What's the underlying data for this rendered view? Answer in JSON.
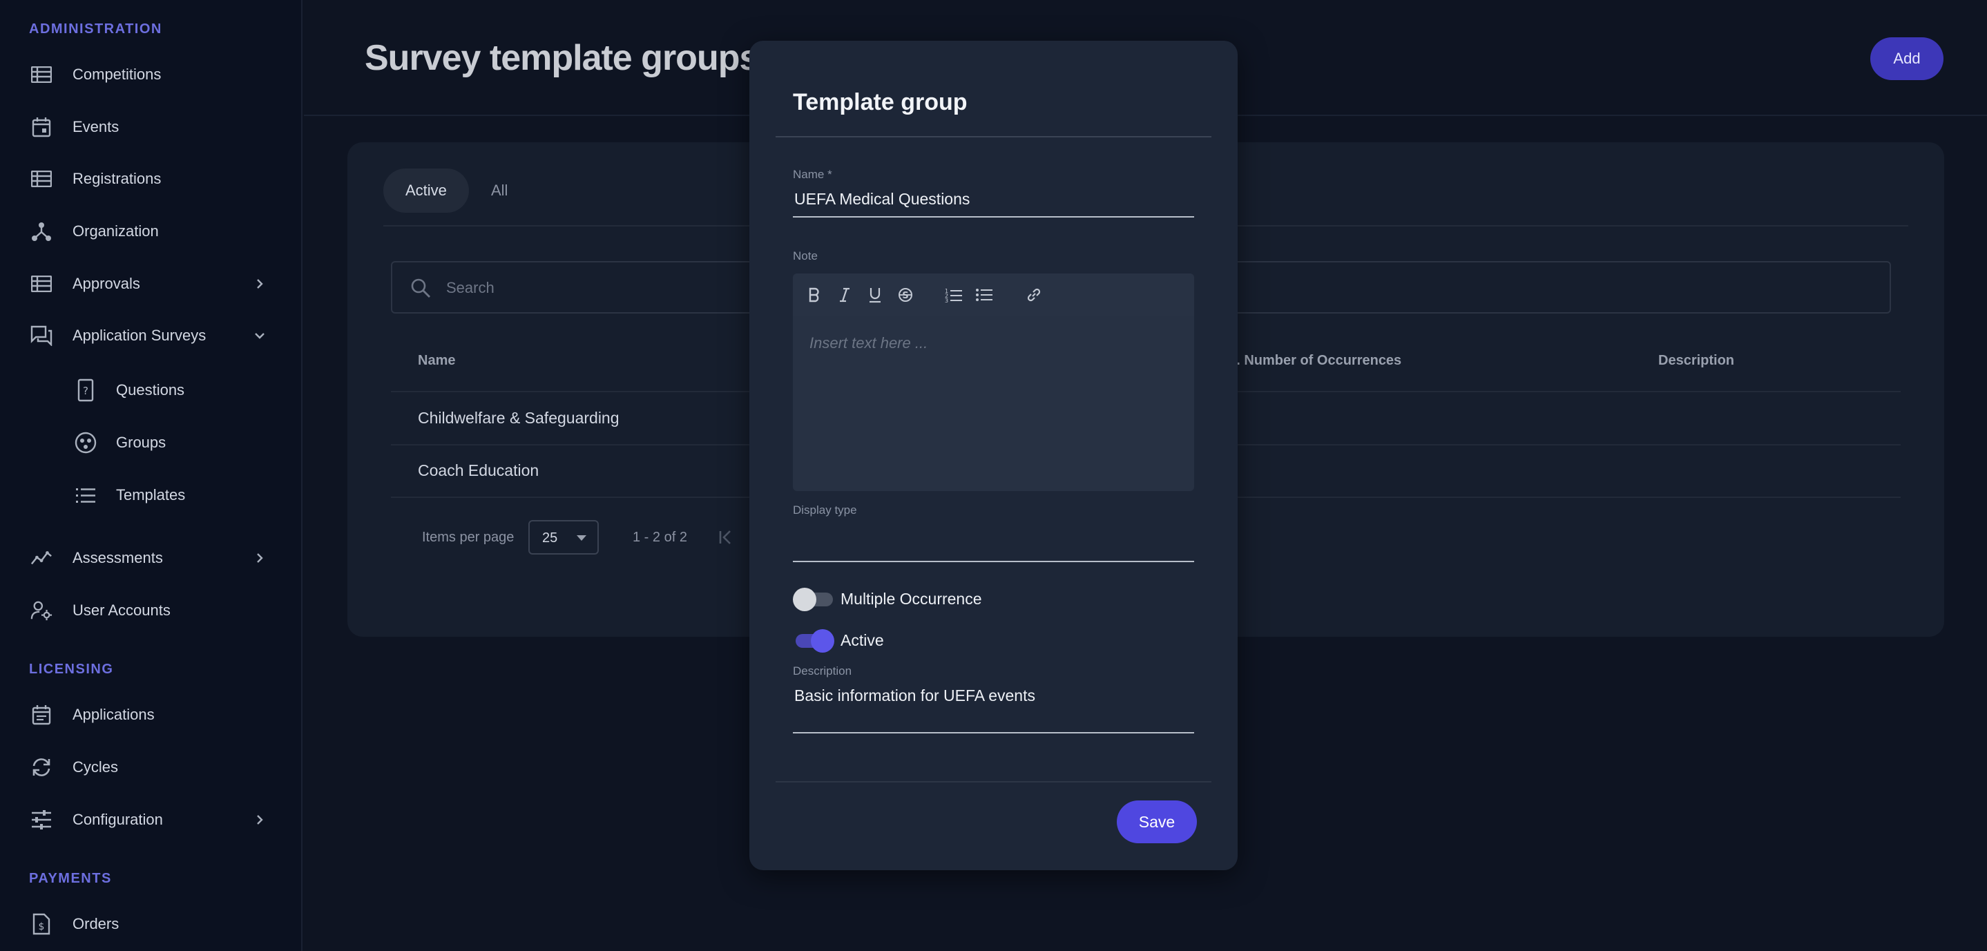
{
  "sidebar": {
    "sections": {
      "administration": "ADMINISTRATION",
      "licensing": "LICENSING",
      "payments": "PAYMENTS"
    },
    "items": {
      "competitions": {
        "label": "Competitions",
        "icon": "table-icon"
      },
      "events": {
        "label": "Events",
        "icon": "calendar-icon"
      },
      "registrations": {
        "label": "Registrations",
        "icon": "table-icon"
      },
      "organization": {
        "label": "Organization",
        "icon": "hierarchy-icon"
      },
      "approvals": {
        "label": "Approvals",
        "icon": "table-icon"
      },
      "application_surveys": {
        "label": "Application Surveys",
        "icon": "chat-icon"
      },
      "questions": {
        "label": "Questions",
        "icon": "question-icon"
      },
      "groups": {
        "label": "Groups",
        "icon": "group-icon"
      },
      "templates": {
        "label": "Templates",
        "icon": "list-icon"
      },
      "assessments": {
        "label": "Assessments",
        "icon": "trend-icon"
      },
      "user_accounts": {
        "label": "User Accounts",
        "icon": "user-gear-icon"
      },
      "applications": {
        "label": "Applications",
        "icon": "calendar-list-icon"
      },
      "cycles": {
        "label": "Cycles",
        "icon": "refresh-icon"
      },
      "configuration": {
        "label": "Configuration",
        "icon": "sliders-icon"
      },
      "orders": {
        "label": "Orders",
        "icon": "invoice-icon"
      }
    }
  },
  "header": {
    "title": "Survey template groups",
    "add_label": "Add"
  },
  "list": {
    "tabs": {
      "active": "Active",
      "all": "All"
    },
    "search_placeholder": "Search",
    "columns": {
      "name": "Name",
      "occurrences": "n. Number of Occurrences",
      "description": "Description"
    },
    "rows": [
      {
        "name": "Childwelfare & Safeguarding"
      },
      {
        "name": "Coach Education"
      }
    ],
    "pager": {
      "items_per_page_label": "Items per page",
      "items_per_page": "25",
      "range": "1 - 2 of 2"
    }
  },
  "dialog": {
    "title": "Template group",
    "name_label": "Name *",
    "name_value": "UEFA Medical Questions",
    "note_label": "Note",
    "note_placeholder": "Insert text here ...",
    "display_type_label": "Display type",
    "multiple_occurrence_label": "Multiple Occurrence",
    "multiple_occurrence_on": false,
    "active_label": "Active",
    "active_on": true,
    "description_label": "Description",
    "description_value": "Basic information for UEFA events",
    "save_label": "Save"
  },
  "colors": {
    "accent": "#4f47e0",
    "section_heading": "#6d6fe0",
    "background": "#0e1422"
  }
}
